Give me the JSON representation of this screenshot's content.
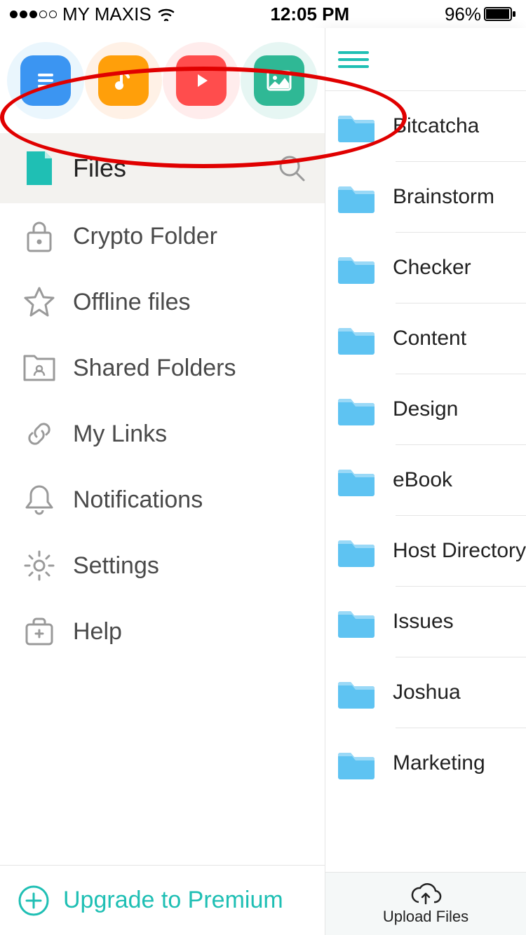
{
  "statusbar": {
    "carrier": "MY MAXIS",
    "time": "12:05 PM",
    "battery": "96%"
  },
  "shortcuts": {
    "docs": "document-icon",
    "music": "music-icon",
    "video": "video-icon",
    "image": "image-icon"
  },
  "menu": {
    "files_label": "Files",
    "items": [
      {
        "label": "Crypto Folder"
      },
      {
        "label": "Offline files"
      },
      {
        "label": "Shared Folders"
      },
      {
        "label": "My Links"
      },
      {
        "label": "Notifications"
      },
      {
        "label": "Settings"
      },
      {
        "label": "Help"
      }
    ],
    "upgrade": "Upgrade to Premium"
  },
  "folders": [
    "Bitcatcha",
    "Brainstorm",
    "Checker",
    "Content",
    "Design",
    "eBook",
    "Host Directory",
    "Issues",
    "Joshua",
    "Marketing"
  ],
  "upload_label": "Upload Files"
}
